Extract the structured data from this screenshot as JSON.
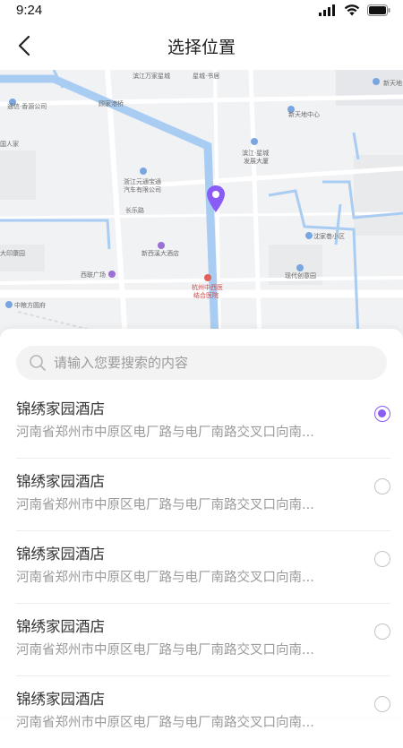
{
  "status_bar": {
    "time": "9:24",
    "signal_icon": "signal-icon",
    "wifi_icon": "wifi-icon",
    "battery_icon": "battery-icon"
  },
  "nav": {
    "title": "选择位置",
    "back_icon": "back-arrow-icon"
  },
  "map": {
    "labels": [
      {
        "text": "滨江万家星城",
        "color": "#6b6b6b"
      },
      {
        "text": "星城·书居",
        "color": "#6b6b6b"
      },
      {
        "text": "新天地",
        "color": "#6b6b6b"
      },
      {
        "text": "通信·香源公司",
        "color": "#6b6b6b"
      },
      {
        "text": "顾家港桥",
        "color": "#6b6b6b"
      },
      {
        "text": "新天地中心",
        "color": "#6b6b6b"
      },
      {
        "text": "国人家",
        "color": "#6b6b6b"
      },
      {
        "text": "滨江·星城",
        "color": "#6b6b6b"
      },
      {
        "text": "发展大厦",
        "color": "#6b6b6b"
      },
      {
        "text": "浙江元通宝通",
        "color": "#6b6b6b"
      },
      {
        "text": "汽车有限公司",
        "color": "#6b6b6b"
      },
      {
        "text": "长乐路",
        "color": "#6b6b6b"
      },
      {
        "text": "沈家巷小区",
        "color": "#6b6b6b"
      },
      {
        "text": "新西溪大酒店",
        "color": "#6b6b6b"
      },
      {
        "text": "大印康园",
        "color": "#6b6b6b"
      },
      {
        "text": "西联广场",
        "color": "#6b6b6b"
      },
      {
        "text": "现代创意园",
        "color": "#6b6b6b"
      },
      {
        "text": "杭州中西医",
        "color": "#d24a4a"
      },
      {
        "text": "结合医院",
        "color": "#d24a4a"
      },
      {
        "text": "中粮方圆府",
        "color": "#6b6b6b"
      }
    ],
    "pin_icon": "location-pin-icon",
    "pin_color": "#8a5cf6"
  },
  "search": {
    "placeholder": "请输入您要搜索的内容",
    "icon": "search-icon"
  },
  "locations": [
    {
      "name": "锦绣家园酒店",
      "address": "河南省郑州市中原区电厂路与电厂南路交叉口向南...",
      "selected": true
    },
    {
      "name": "锦绣家园酒店",
      "address": "河南省郑州市中原区电厂路与电厂南路交叉口向南...",
      "selected": false
    },
    {
      "name": "锦绣家园酒店",
      "address": "河南省郑州市中原区电厂路与电厂南路交叉口向南...",
      "selected": false
    },
    {
      "name": "锦绣家园酒店",
      "address": "河南省郑州市中原区电厂路与电厂南路交叉口向南...",
      "selected": false
    },
    {
      "name": "锦绣家园酒店",
      "address": "河南省郑州市中原区电厂路与电厂南路交叉口向南...",
      "selected": false
    }
  ],
  "colors": {
    "accent": "#8a5cf6",
    "river": "#a9cdf2",
    "map_bg": "#f1f2f4"
  }
}
